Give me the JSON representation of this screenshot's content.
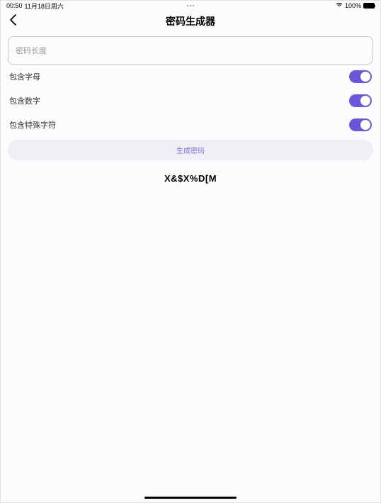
{
  "statusBar": {
    "time": "00:50",
    "date": "11月18日周六",
    "batteryPercent": "100%"
  },
  "header": {
    "title": "密码生成器"
  },
  "input": {
    "placeholder": "密码长度"
  },
  "options": {
    "letters": {
      "label": "包含字母",
      "enabled": true
    },
    "numbers": {
      "label": "包含数字",
      "enabled": true
    },
    "special": {
      "label": "包含特殊字符",
      "enabled": true
    }
  },
  "generateButton": {
    "label": "生成密码"
  },
  "output": {
    "password": "X&$X%D[M"
  }
}
